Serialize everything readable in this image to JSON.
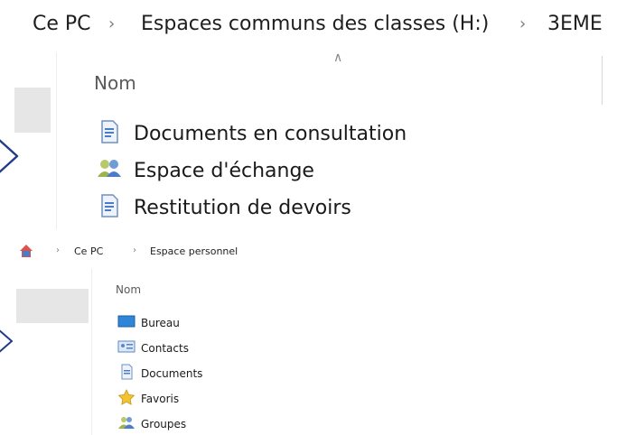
{
  "explorer_top": {
    "breadcrumb": [
      "Ce PC",
      "Espaces communs des classes (H:)",
      "3EME"
    ],
    "column_header": "Nom",
    "items": [
      {
        "label": "Documents en consultation",
        "icon": "shared-doc-icon"
      },
      {
        "label": "Espace d'échange",
        "icon": "users-group-icon"
      },
      {
        "label": "Restitution de devoirs",
        "icon": "shared-doc-icon"
      }
    ]
  },
  "explorer_bottom": {
    "breadcrumb": [
      "Ce PC",
      "Espace personnel"
    ],
    "column_header": "Nom",
    "items": [
      {
        "label": "Bureau",
        "icon": "desktop-folder-icon"
      },
      {
        "label": "Contacts",
        "icon": "contacts-folder-icon"
      },
      {
        "label": "Documents",
        "icon": "documents-folder-icon"
      },
      {
        "label": "Favoris",
        "icon": "favorites-star-icon"
      },
      {
        "label": "Groupes",
        "icon": "users-group-icon"
      }
    ]
  },
  "colors": {
    "nav_highlight": "#e6e6e6",
    "arrow_fill": "#ffffff",
    "arrow_stroke": "#1f3c88"
  }
}
